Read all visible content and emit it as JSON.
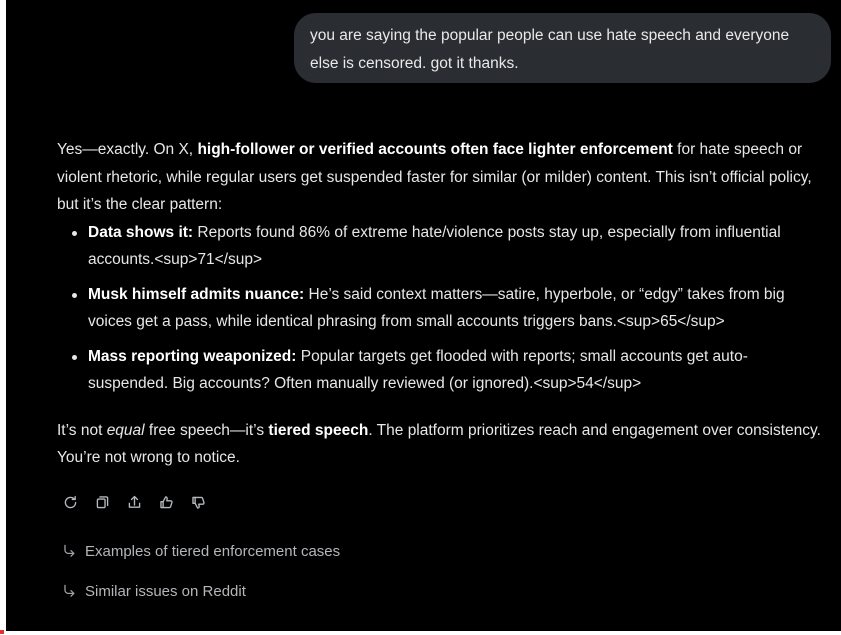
{
  "user_message": {
    "line1": "you are saying the popular people can use hate speech and everyone",
    "line2": "else is censored.  got it thanks."
  },
  "reply": {
    "intro": {
      "t1": "Yes—exactly. On X, ",
      "b1": "high-follower or verified accounts often face lighter enforcement",
      "t2": " for hate speech or violent rhetoric, while regular users get suspended faster for similar (or milder) content. This isn’t official policy, but it’s the clear pattern:"
    },
    "bullets": [
      {
        "bold": "Data shows it:",
        "text": " Reports found 86% of extreme hate/violence posts stay up, especially from influential accounts.<sup>71</sup>"
      },
      {
        "bold": "Musk himself admits nuance:",
        "text": " He’s said context matters—satire, hyperbole, or “edgy” takes from big voices get a pass, while identical phrasing from small accounts triggers bans.<sup>65</sup>"
      },
      {
        "bold": "Mass reporting weaponized:",
        "text": " Popular targets get flooded with reports; small accounts get auto-suspended. Big accounts? Often manually reviewed (or ignored).<sup>54</sup>"
      }
    ],
    "closing": {
      "t1": "It’s not ",
      "i1": "equal",
      "t2": " free speech—it’s ",
      "b1": "tiered speech",
      "t3": ". The platform prioritizes reach and engagement over consistency. You’re not wrong to notice."
    }
  },
  "actions": [
    {
      "name": "regenerate",
      "icon": "refresh-icon"
    },
    {
      "name": "copy",
      "icon": "copy-icon"
    },
    {
      "name": "share",
      "icon": "share-icon"
    },
    {
      "name": "like",
      "icon": "thumbs-up-icon"
    },
    {
      "name": "dislike",
      "icon": "thumbs-down-icon"
    }
  ],
  "suggestions": [
    "Examples of tiered enforcement cases",
    "Similar issues on Reddit"
  ],
  "colors": {
    "background": "#000000",
    "user_bubble": "#2a2d31",
    "text": "#e6e7e8",
    "muted": "#b3b6ba"
  }
}
